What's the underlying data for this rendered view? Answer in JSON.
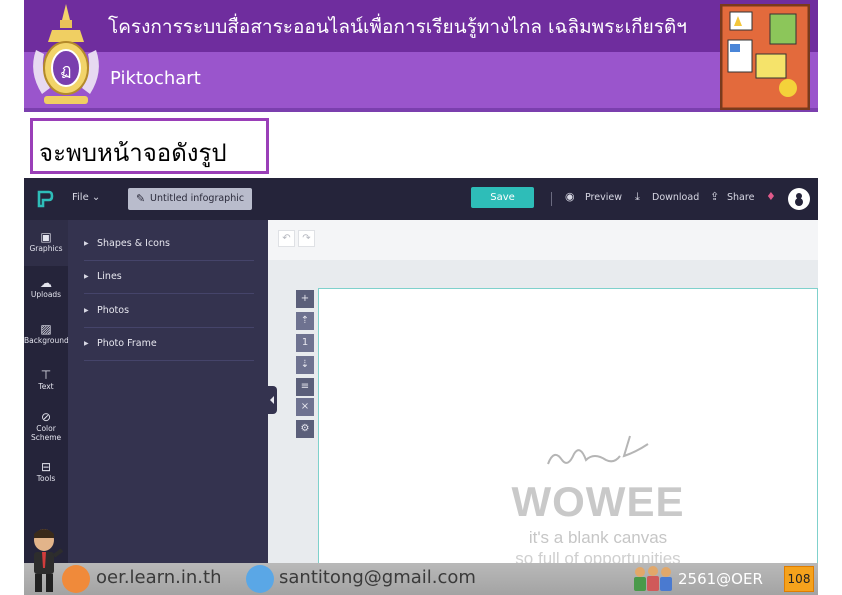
{
  "slide": {
    "header_title": "โครงการระบบสื่อสาระออนไลน์เพื่อการเรียนรู้ทางไกล เฉลิมพระเกียรติฯ",
    "header_subtitle": "Piktochart",
    "caption": "จะพบหน้าจอดังรูป"
  },
  "app": {
    "topbar": {
      "logo_icon": "piktochart-logo-icon",
      "file_menu": "File ⌄",
      "title_field": "Untitled infographic",
      "save_label": "Save",
      "preview_label": "Preview",
      "download_label": "Download",
      "share_label": "Share"
    },
    "rail": [
      {
        "label": "Graphics",
        "icon": "image-icon"
      },
      {
        "label": "Uploads",
        "icon": "cloud-upload-icon"
      },
      {
        "label": "Background",
        "icon": "hatch-icon"
      },
      {
        "label": "Text",
        "icon": "text-icon"
      },
      {
        "label": "Color Scheme",
        "icon": "palette-icon"
      },
      {
        "label": "Tools",
        "icon": "toolbox-icon"
      }
    ],
    "panel": [
      "Shapes & Icons",
      "Lines",
      "Photos",
      "Photo Frame"
    ],
    "canvas": {
      "wowee": "WOWEE",
      "line1": "it's a blank canvas",
      "line2": "so full of opportunities"
    }
  },
  "footer": {
    "website": "oer.learn.in.th",
    "email": "santitong@gmail.com",
    "year": "2561@OER",
    "page": "108"
  },
  "colors": {
    "header_dark": "#6f2d9e",
    "header_light": "#9a55cc",
    "app_dark": "#25243a",
    "save_button": "#2ebdb8",
    "page_badge": "#f5a21c"
  }
}
